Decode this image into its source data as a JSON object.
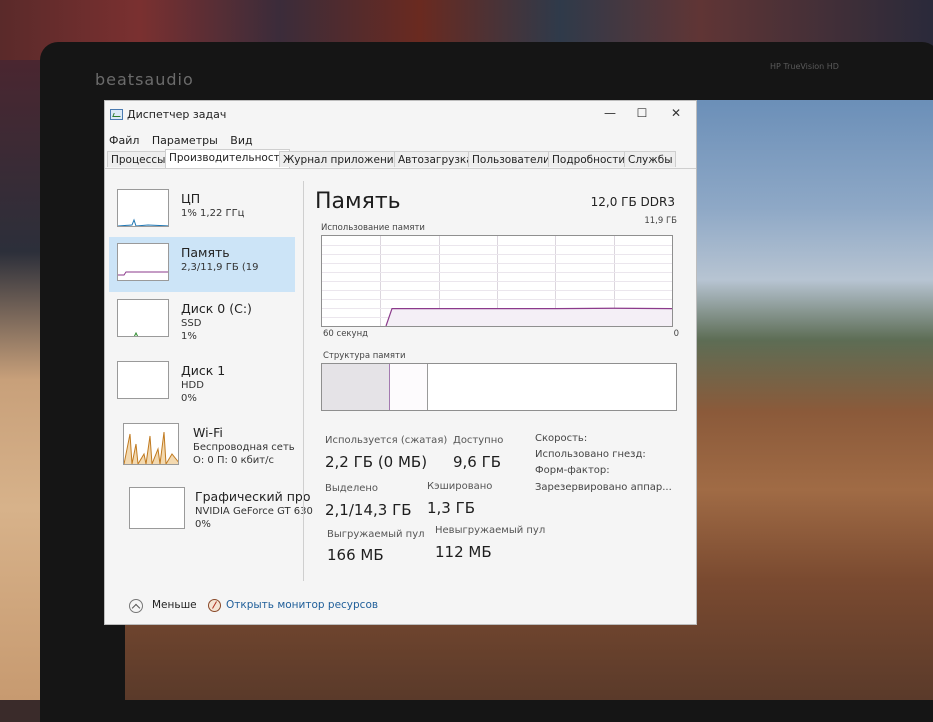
{
  "brand": "beatsaudio",
  "camera_label": "HP TrueVision HD",
  "window": {
    "title": "Диспетчер задач",
    "minimize": "—",
    "maximize": "☐",
    "close": "✕"
  },
  "menu": [
    "Файл",
    "Параметры",
    "Вид"
  ],
  "tabs": [
    "Процессы",
    "Производительность",
    "Журнал приложений",
    "Автозагрузка",
    "Пользователи",
    "Подробности",
    "Службы"
  ],
  "sidebar": [
    {
      "name": "ЦП",
      "line1": "1% 1,22 ГГц",
      "line2": ""
    },
    {
      "name": "Память",
      "line1": "2,3/11,9 ГБ (19",
      "line2": ""
    },
    {
      "name": "Диск 0 (C:)",
      "line1": "SSD",
      "line2": "1%"
    },
    {
      "name": "Диск 1",
      "line1": "HDD",
      "line2": "0%"
    },
    {
      "name": "Wi-Fi",
      "line1": "Беспроводная сеть",
      "line2": "О: 0 П: 0 кбит/с"
    },
    {
      "name": "Графический про",
      "line1": "NVIDIA GeForce GT 630",
      "line2": "0%"
    }
  ],
  "main": {
    "title": "Память",
    "spec": "12,0 ГБ DDR3",
    "graph_label": "Использование памяти",
    "graph_max": "11,9 ГБ",
    "graph_time": "60 секунд",
    "graph_zero": "0",
    "structure_label": "Структура памяти",
    "stats": {
      "in_use_label": "Используется (сжатая)",
      "in_use_value": "2,2 ГБ (0 МБ)",
      "available_label": "Доступно",
      "available_value": "9,6 ГБ",
      "committed_label": "Выделено",
      "committed_value": "2,1/14,3 ГБ",
      "cached_label": "Кэшировано",
      "cached_value": "1,3 ГБ",
      "paged_label": "Выгружаемый пул",
      "paged_value": "166 МБ",
      "nonpaged_label": "Невыгружаемый пул",
      "nonpaged_value": "112 МБ"
    },
    "specs": [
      "Скорость:",
      "Использовано гнезд:",
      "Форм-фактор:",
      "Зарезервировано аппар..."
    ]
  },
  "footer": {
    "less": "Меньше",
    "resource_monitor": "Открыть монитор ресурсов"
  },
  "chart_data": {
    "type": "line",
    "title": "Использование памяти",
    "x": [
      60,
      50,
      48,
      40,
      30,
      20,
      10,
      0
    ],
    "values": [
      null,
      null,
      2.3,
      2.3,
      2.3,
      2.3,
      2.35,
      2.3
    ],
    "ylim": [
      0,
      11.9
    ],
    "xlabel": "60 секунд",
    "grid": true
  }
}
